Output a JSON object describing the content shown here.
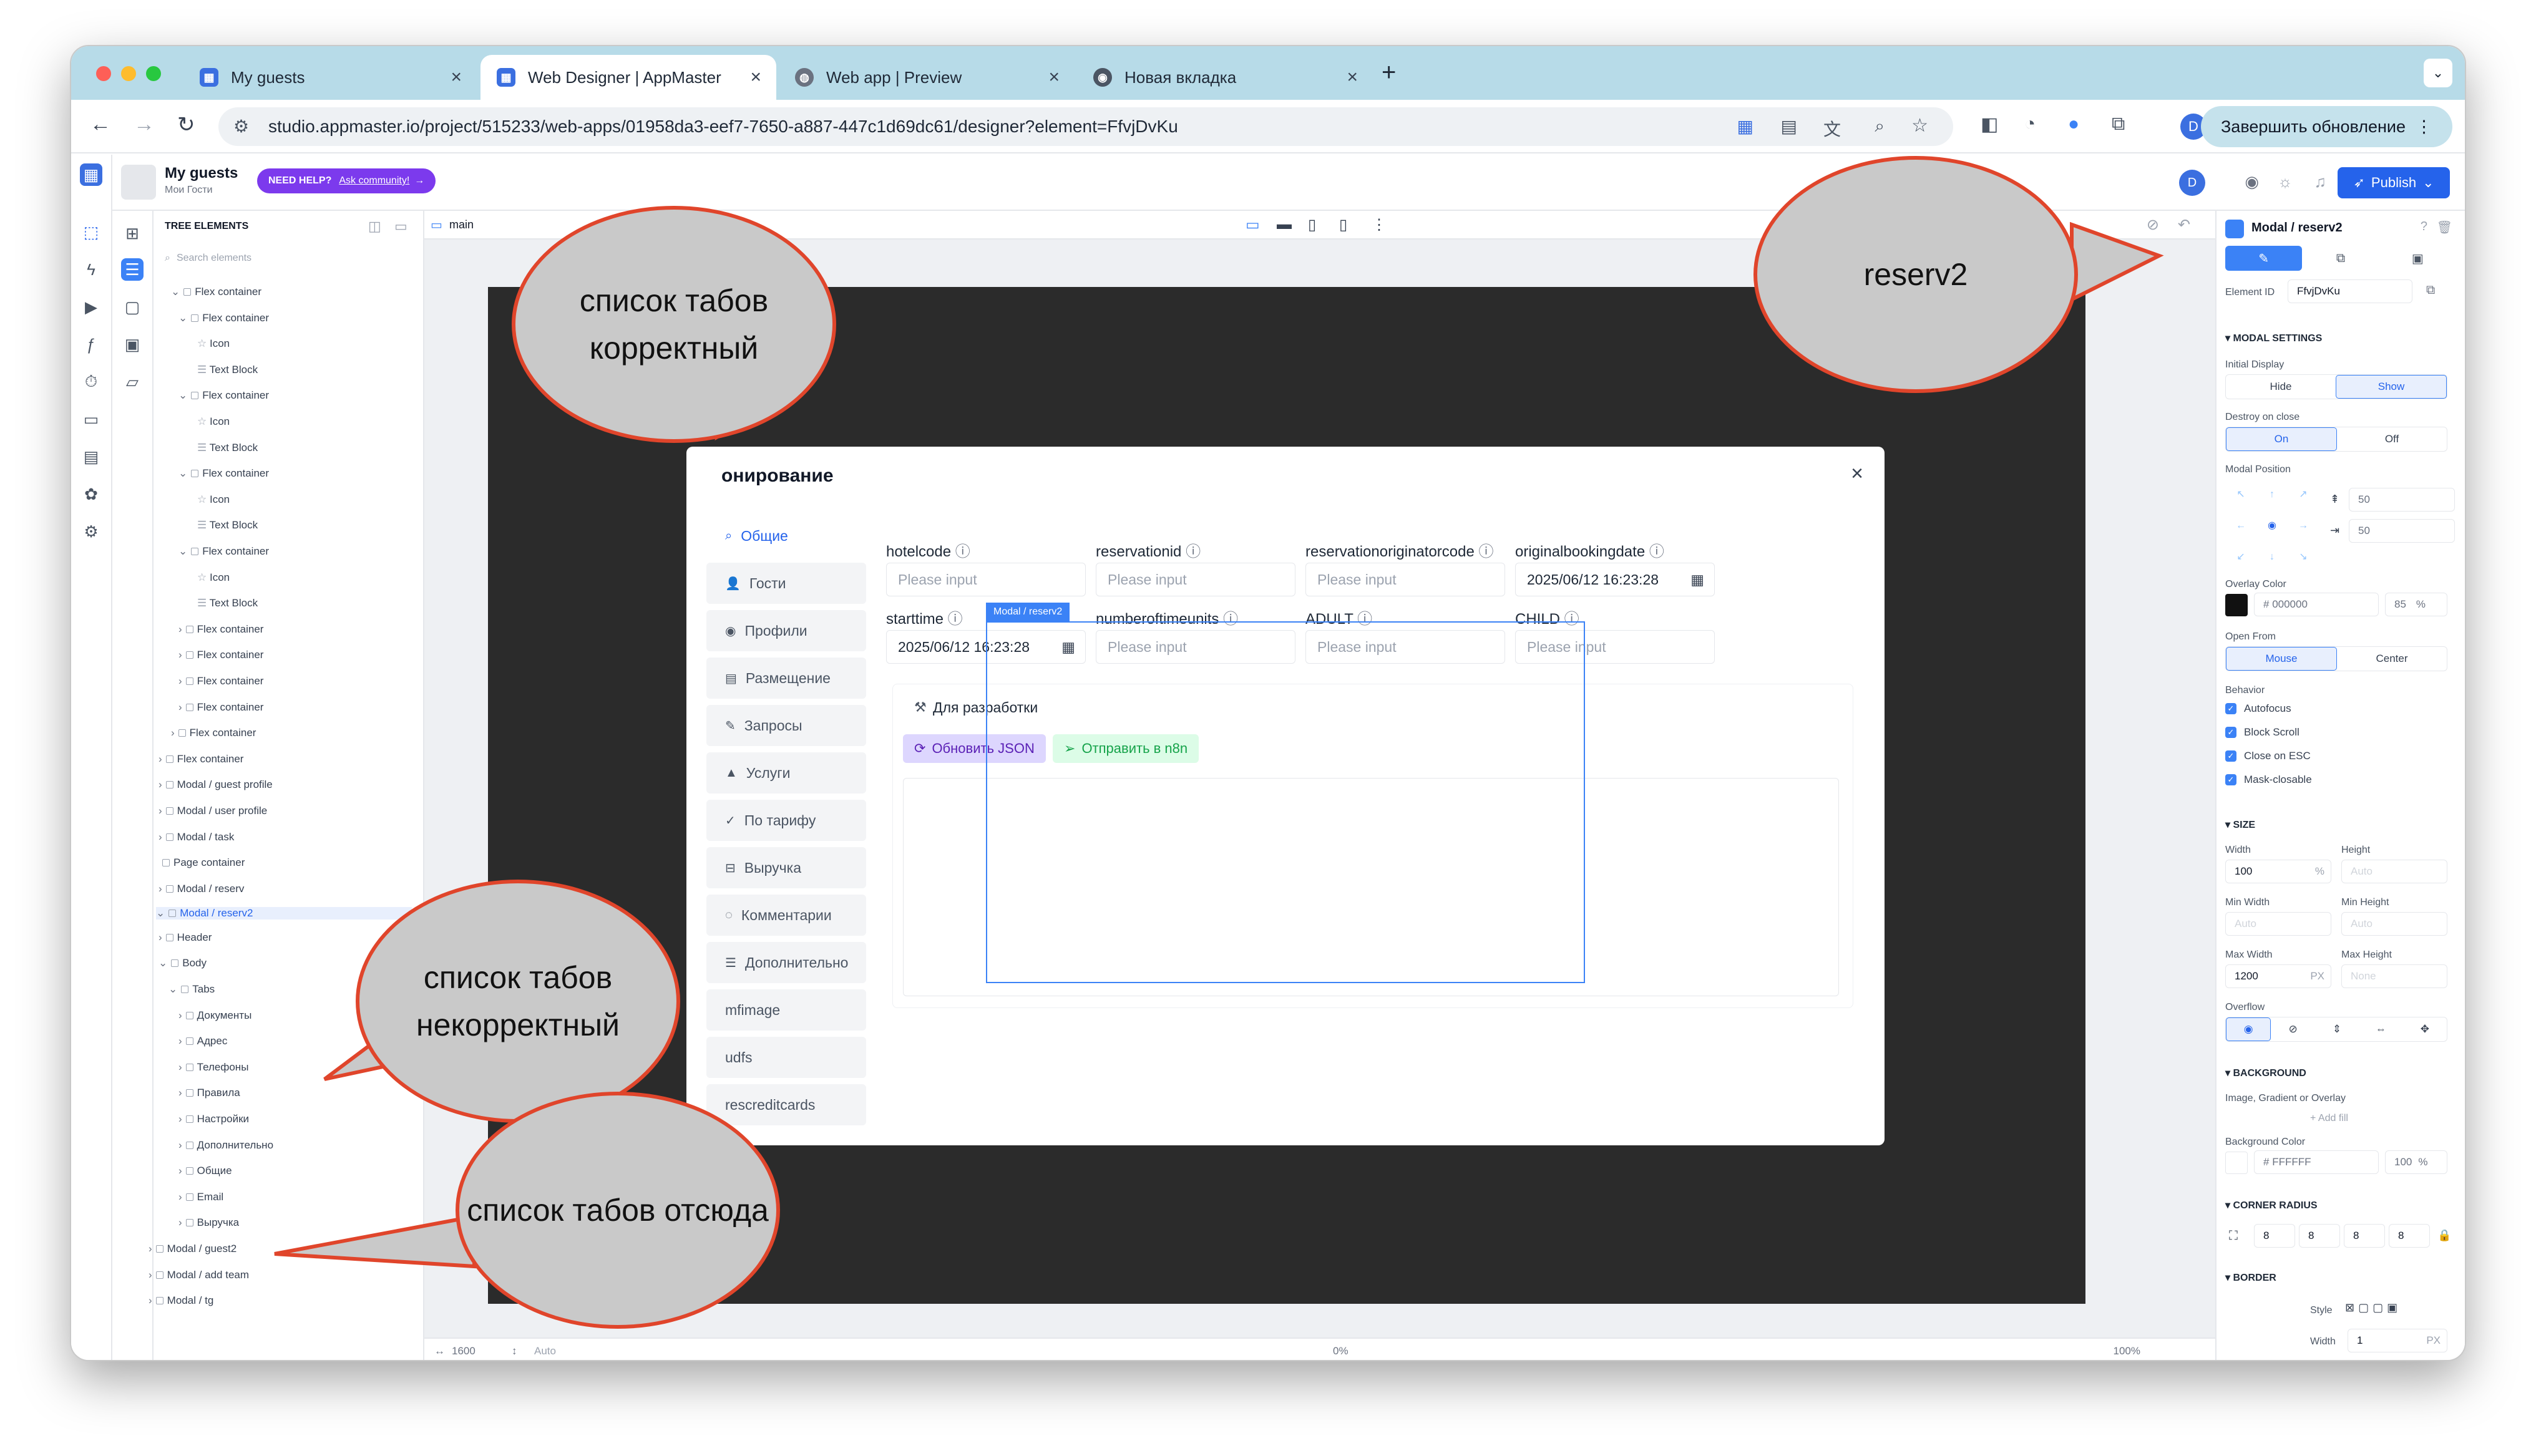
{
  "browser": {
    "tabs": [
      {
        "title": "My guests",
        "icon": "appmaster-icon"
      },
      {
        "title": "Web Designer | AppMaster",
        "icon": "appmaster-icon"
      },
      {
        "title": "Web app | Preview",
        "icon": "globe-icon"
      },
      {
        "title": "Новая вкладка",
        "icon": "chrome-icon"
      }
    ],
    "url": "studio.appmaster.io/project/515233/web-apps/01958da3-eef7-7650-a887-447c1d69dc61/designer?element=FfvjDvKu",
    "update_button": "Завершить обновление",
    "profile_initial": "D"
  },
  "app": {
    "project_name": "My guests",
    "project_sub": "Мои Гости",
    "need_help": "NEED HELP?",
    "ask_community": "Ask community!",
    "publish": "Publish",
    "user_initial": "D"
  },
  "tree": {
    "header": "TREE ELEMENTS",
    "search_placeholder": "Search elements",
    "rows": [
      "Flex container",
      "Flex container",
      "Icon",
      "Text Block",
      "Flex container",
      "Icon",
      "Text Block",
      "Flex container",
      "Icon",
      "Text Block",
      "Flex container",
      "Icon",
      "Text Block",
      "Flex container",
      "Flex container",
      "Flex container",
      "Flex container",
      "Flex container",
      "Flex container",
      "Modal / guest profile",
      "Modal / user profile",
      "Modal / task",
      "Page container",
      "Modal / reserv",
      "Modal / reserv2",
      "Header",
      "Body",
      "Tabs",
      "Документы",
      "Адрес",
      "Телефоны",
      "Правила",
      "Настройки",
      "Дополнительно",
      "Общие",
      "Email",
      "Выручка",
      "Modal / guest2",
      "Modal / add team",
      "Modal / tg"
    ]
  },
  "canvas": {
    "page_name": "main",
    "width": "1600",
    "height": "Auto",
    "zoom": "100%",
    "offset": "0%"
  },
  "modal": {
    "title": "онирование",
    "selection_label": "Modal / reserv2",
    "tabs": [
      "Общие",
      "Гости",
      "Профили",
      "Размещение",
      "Запросы",
      "Услуги",
      "По тарифу",
      "Выручка",
      "Комментарии",
      "Дополнительно",
      "mfimage",
      "udfs",
      "rescreditcards"
    ],
    "fields": [
      {
        "label": "hotelcode",
        "value": "Please input"
      },
      {
        "label": "reservationid",
        "value": "Please input"
      },
      {
        "label": "reservationoriginatorcode",
        "value": "Please input"
      },
      {
        "label": "originalbookingdate",
        "value": "2025/06/12 16:23:28"
      },
      {
        "label": "starttime",
        "value": "2025/06/12 16:23:28"
      },
      {
        "label": "numberoftimeunits",
        "value": "Please input"
      },
      {
        "label": "ADULT",
        "value": "Please input"
      },
      {
        "label": "CHILD",
        "value": "Please input"
      }
    ],
    "dev_title": "Для разработки",
    "update_json": "Обновить JSON",
    "send_n8n": "Отправить в n8n"
  },
  "right_panel": {
    "element_title": "Modal / reserv2",
    "element_id_label": "Element ID",
    "element_id": "FfvjDvKu",
    "modal_settings": "MODAL SETTINGS",
    "initial_display": "Initial Display",
    "hide": "Hide",
    "show": "Show",
    "destroy_on_close": "Destroy on close",
    "on": "On",
    "off": "Off",
    "modal_position": "Modal Position",
    "pos_top": "50",
    "pos_left": "50",
    "overlay_color": "Overlay Color",
    "overlay_hex": "000000",
    "overlay_opacity": "85",
    "open_from": "Open From",
    "mouse": "Mouse",
    "center": "Center",
    "behavior": "Behavior",
    "behaviors": [
      "Autofocus",
      "Block Scroll",
      "Close on ESC",
      "Mask-closable"
    ],
    "size": "SIZE",
    "width_label": "Width",
    "width_val": "100",
    "width_unit": "%",
    "height_label": "Height",
    "auto": "Auto",
    "min_width": "Min Width",
    "min_height": "Min Height",
    "max_width": "Max Width",
    "max_width_val": "1200",
    "px": "PX",
    "max_height": "Max Height",
    "none": "None",
    "overflow": "Overflow",
    "background": "BACKGROUND",
    "image_gradient": "Image, Gradient or Overlay",
    "add_fill": "+ Add fill",
    "bg_color": "Background Color",
    "bg_hex": "FFFFFF",
    "bg_opacity": "100",
    "corner_radius": "CORNER RADIUS",
    "radii": [
      "8",
      "8",
      "8",
      "8"
    ],
    "border": "BORDER",
    "style": "Style",
    "border_width_label": "Width",
    "border_width": "1"
  },
  "callouts": {
    "correct": "список табов корректный",
    "incorrect": "список табов некорректный",
    "from_here": "список табов отсюда",
    "reserv2": "reserv2"
  },
  "colors": {
    "accent": "#3b82f6",
    "callout_border": "#e0452b",
    "callout_fill": "#c9c9c9",
    "tabbar": "#b7dbe8"
  }
}
